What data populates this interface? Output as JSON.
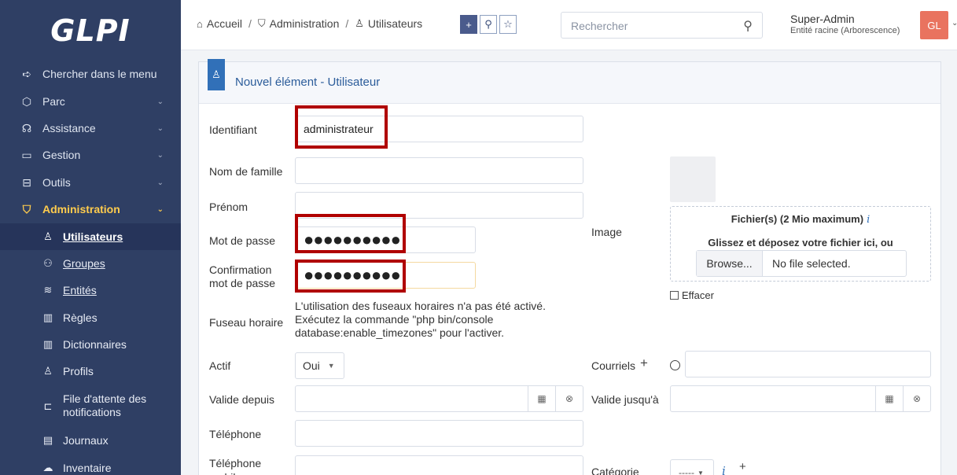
{
  "logo": "GLPI",
  "sidebar": {
    "search_menu": "Chercher dans le menu",
    "items": [
      {
        "label": "Parc"
      },
      {
        "label": "Assistance"
      },
      {
        "label": "Gestion"
      },
      {
        "label": "Outils"
      },
      {
        "label": "Administration"
      }
    ],
    "admin_sub": [
      {
        "label": "Utilisateurs"
      },
      {
        "label": "Groupes"
      },
      {
        "label": "Entités"
      },
      {
        "label": "Règles"
      },
      {
        "label": "Dictionnaires"
      },
      {
        "label": "Profils"
      },
      {
        "label": "File d'attente des notifications"
      },
      {
        "label": "Journaux"
      },
      {
        "label": "Inventaire"
      }
    ]
  },
  "breadcrumb": {
    "home": "Accueil",
    "admin": "Administration",
    "users": "Utilisateurs"
  },
  "search": {
    "placeholder": "Rechercher"
  },
  "user": {
    "name": "Super-Admin",
    "entity": "Entité racine (Arborescence)",
    "initials": "GL"
  },
  "form": {
    "title": "Nouvel élément - Utilisateur",
    "login_label": "Identifiant",
    "login_value": "administrateur",
    "lastname_label": "Nom de famille",
    "firstname_label": "Prénom",
    "password_label": "Mot de passe",
    "password_value": "●●●●●●●●●●",
    "confirm_label_1": "Confirmation",
    "confirm_label_2": "mot de passe",
    "confirm_value": "●●●●●●●●●●",
    "timezone_label": "Fuseau horaire",
    "timezone_note": "L'utilisation des fuseaux horaires n'a pas été activé. Exécutez la commande \"php bin/console database:enable_timezones\" pour l'activer.",
    "active_label": "Actif",
    "active_value": "Oui",
    "valid_from_label": "Valide depuis",
    "valid_until_label": "Valide jusqu'à",
    "phone_label": "Téléphone",
    "mobile_label": "Téléphone mobile",
    "image_label": "Image",
    "upload_title": "Fichier(s) (2 Mio maximum)",
    "upload_drop": "Glissez et déposez votre fichier ici, ou",
    "browse_label": "Browse...",
    "no_file": "No file selected.",
    "clear_label": "Effacer",
    "emails_label": "Courriels",
    "category_label": "Catégorie",
    "category_value": "-----"
  }
}
